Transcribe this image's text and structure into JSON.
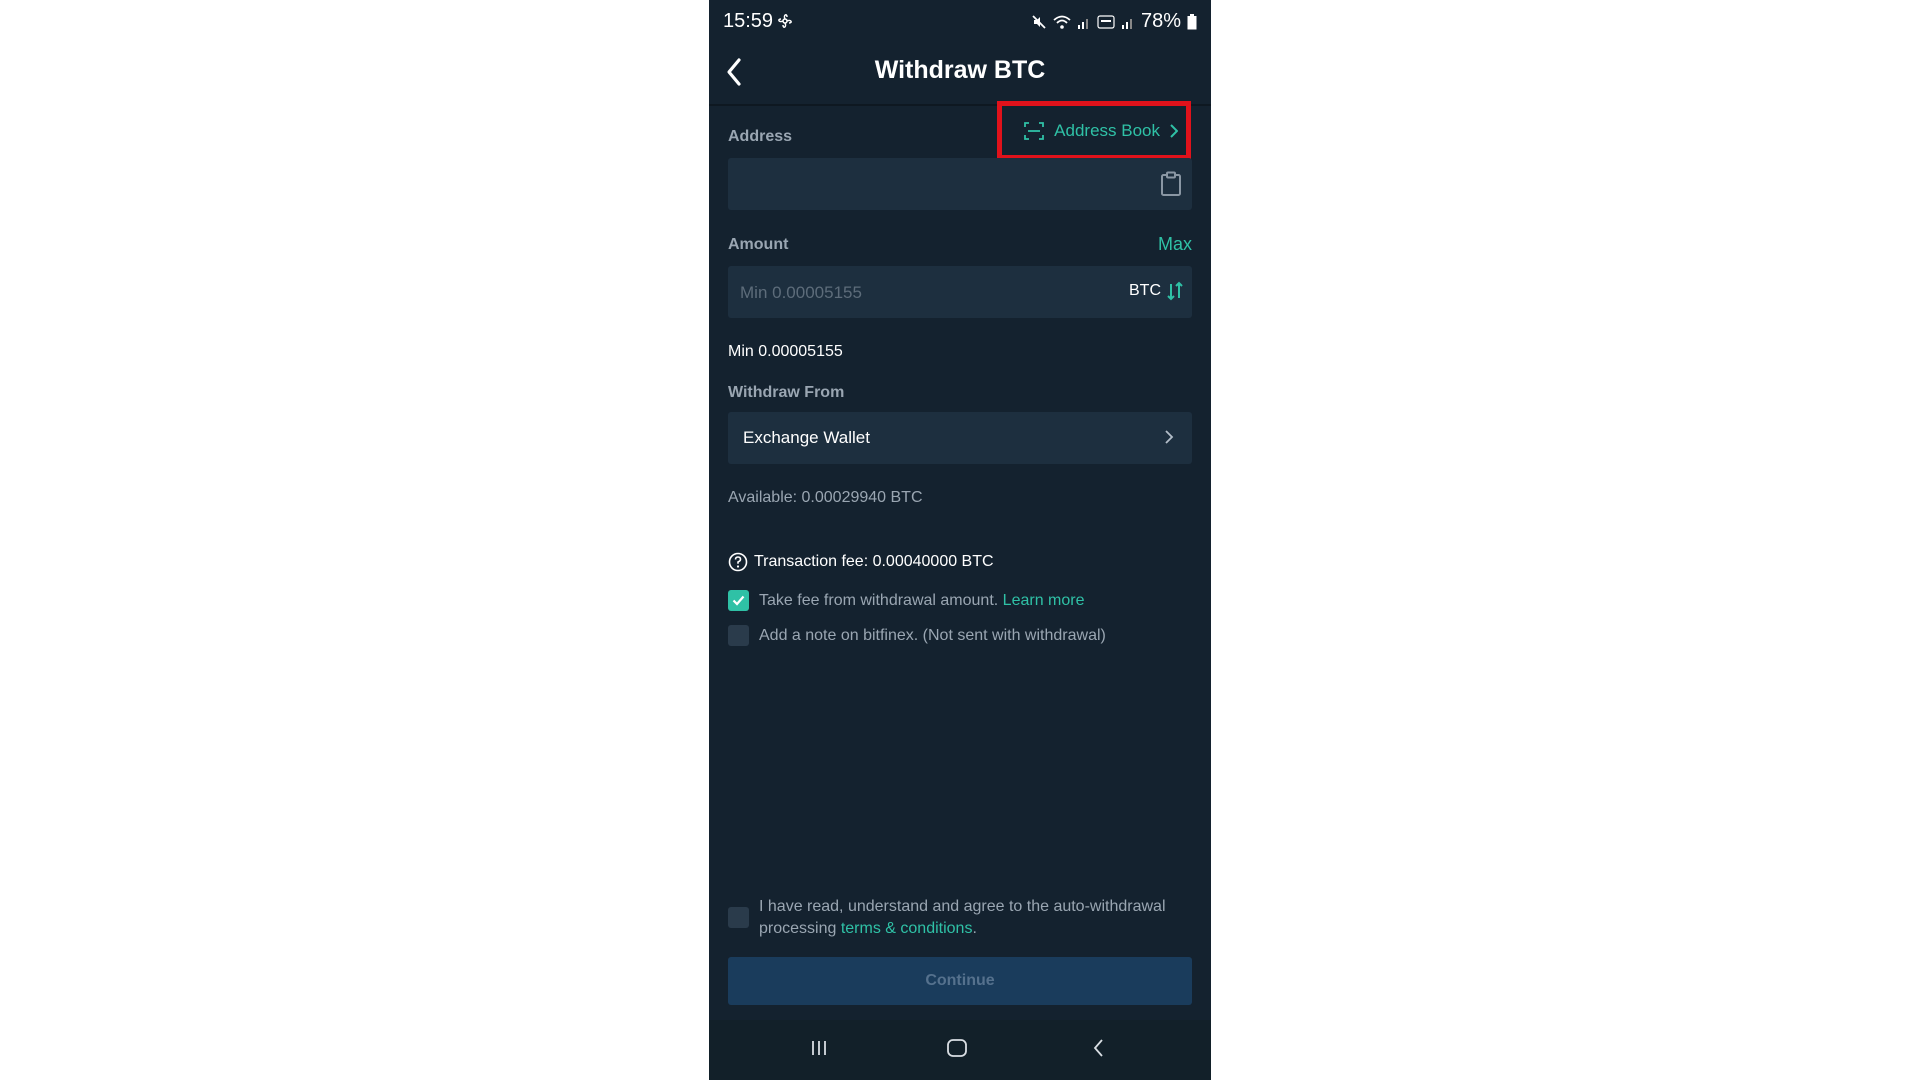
{
  "status_bar": {
    "time": "15:59",
    "battery": "78%"
  },
  "header": {
    "title": "Withdraw BTC"
  },
  "address": {
    "label": "Address",
    "address_book_label": "Address Book",
    "value": ""
  },
  "amount": {
    "label": "Amount",
    "max_label": "Max",
    "placeholder": "Min 0.00005155",
    "currency": "BTC",
    "min_text": "Min 0.00005155"
  },
  "withdraw_from": {
    "label": "Withdraw From",
    "wallet": "Exchange Wallet",
    "available": "Available: 0.00029940 BTC"
  },
  "fee": {
    "text": "Transaction fee: 0.00040000 BTC",
    "take_fee_text": "Take fee from withdrawal amount.",
    "take_fee_checked": true,
    "learn_more": "Learn more",
    "note_text": "Add a note on bitfinex. (Not sent with withdrawal)",
    "note_checked": false
  },
  "terms": {
    "text": "I have read, understand and agree to the auto-withdrawal processing",
    "link": "terms & conditions",
    "suffix": ".",
    "checked": false
  },
  "continue_label": "Continue",
  "colors": {
    "accent": "#2fc1a6",
    "background": "#14222f",
    "field": "#1d2f3f",
    "highlight_box": "#e0121b"
  }
}
